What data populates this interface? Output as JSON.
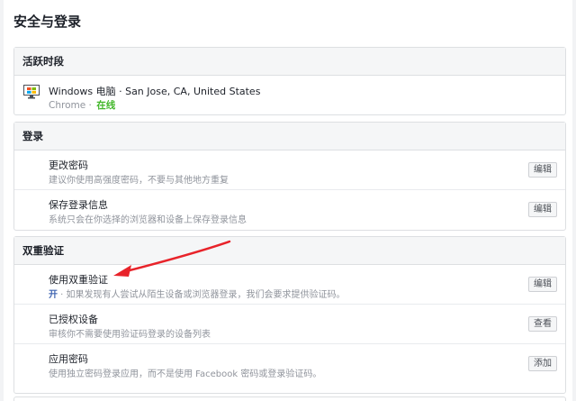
{
  "page": {
    "title": "安全与登录"
  },
  "active_sessions": {
    "header": "活跃时段",
    "device": {
      "name": "Windows 电脑 · San Jose, CA, United States",
      "browser": "Chrome · ",
      "status": "在线"
    }
  },
  "login": {
    "header": "登录",
    "rows": [
      {
        "title": "更改密码",
        "desc": "建议你使用高强度密码，不要与其他地方重复",
        "button": "编辑"
      },
      {
        "title": "保存登录信息",
        "desc": "系统只会在你选择的浏览器和设备上保存登录信息",
        "button": "编辑"
      }
    ]
  },
  "two_factor": {
    "header": "双重验证",
    "rows": [
      {
        "title": "使用双重验证",
        "status": "开",
        "desc": " · 如果发现有人尝试从陌生设备或浏览器登录，我们会要求提供验证码。",
        "button": "编辑"
      },
      {
        "title": "已授权设备",
        "desc": "审核你不需要使用验证码登录的设备列表",
        "button": "查看"
      },
      {
        "title": "应用密码",
        "desc": "使用独立密码登录应用，而不是使用 Facebook 密码或登录验证码。",
        "button": "添加"
      }
    ]
  },
  "colors": {
    "online": "#42b72a",
    "on_badge": "#4267b2",
    "arrow": "#e8232a"
  }
}
